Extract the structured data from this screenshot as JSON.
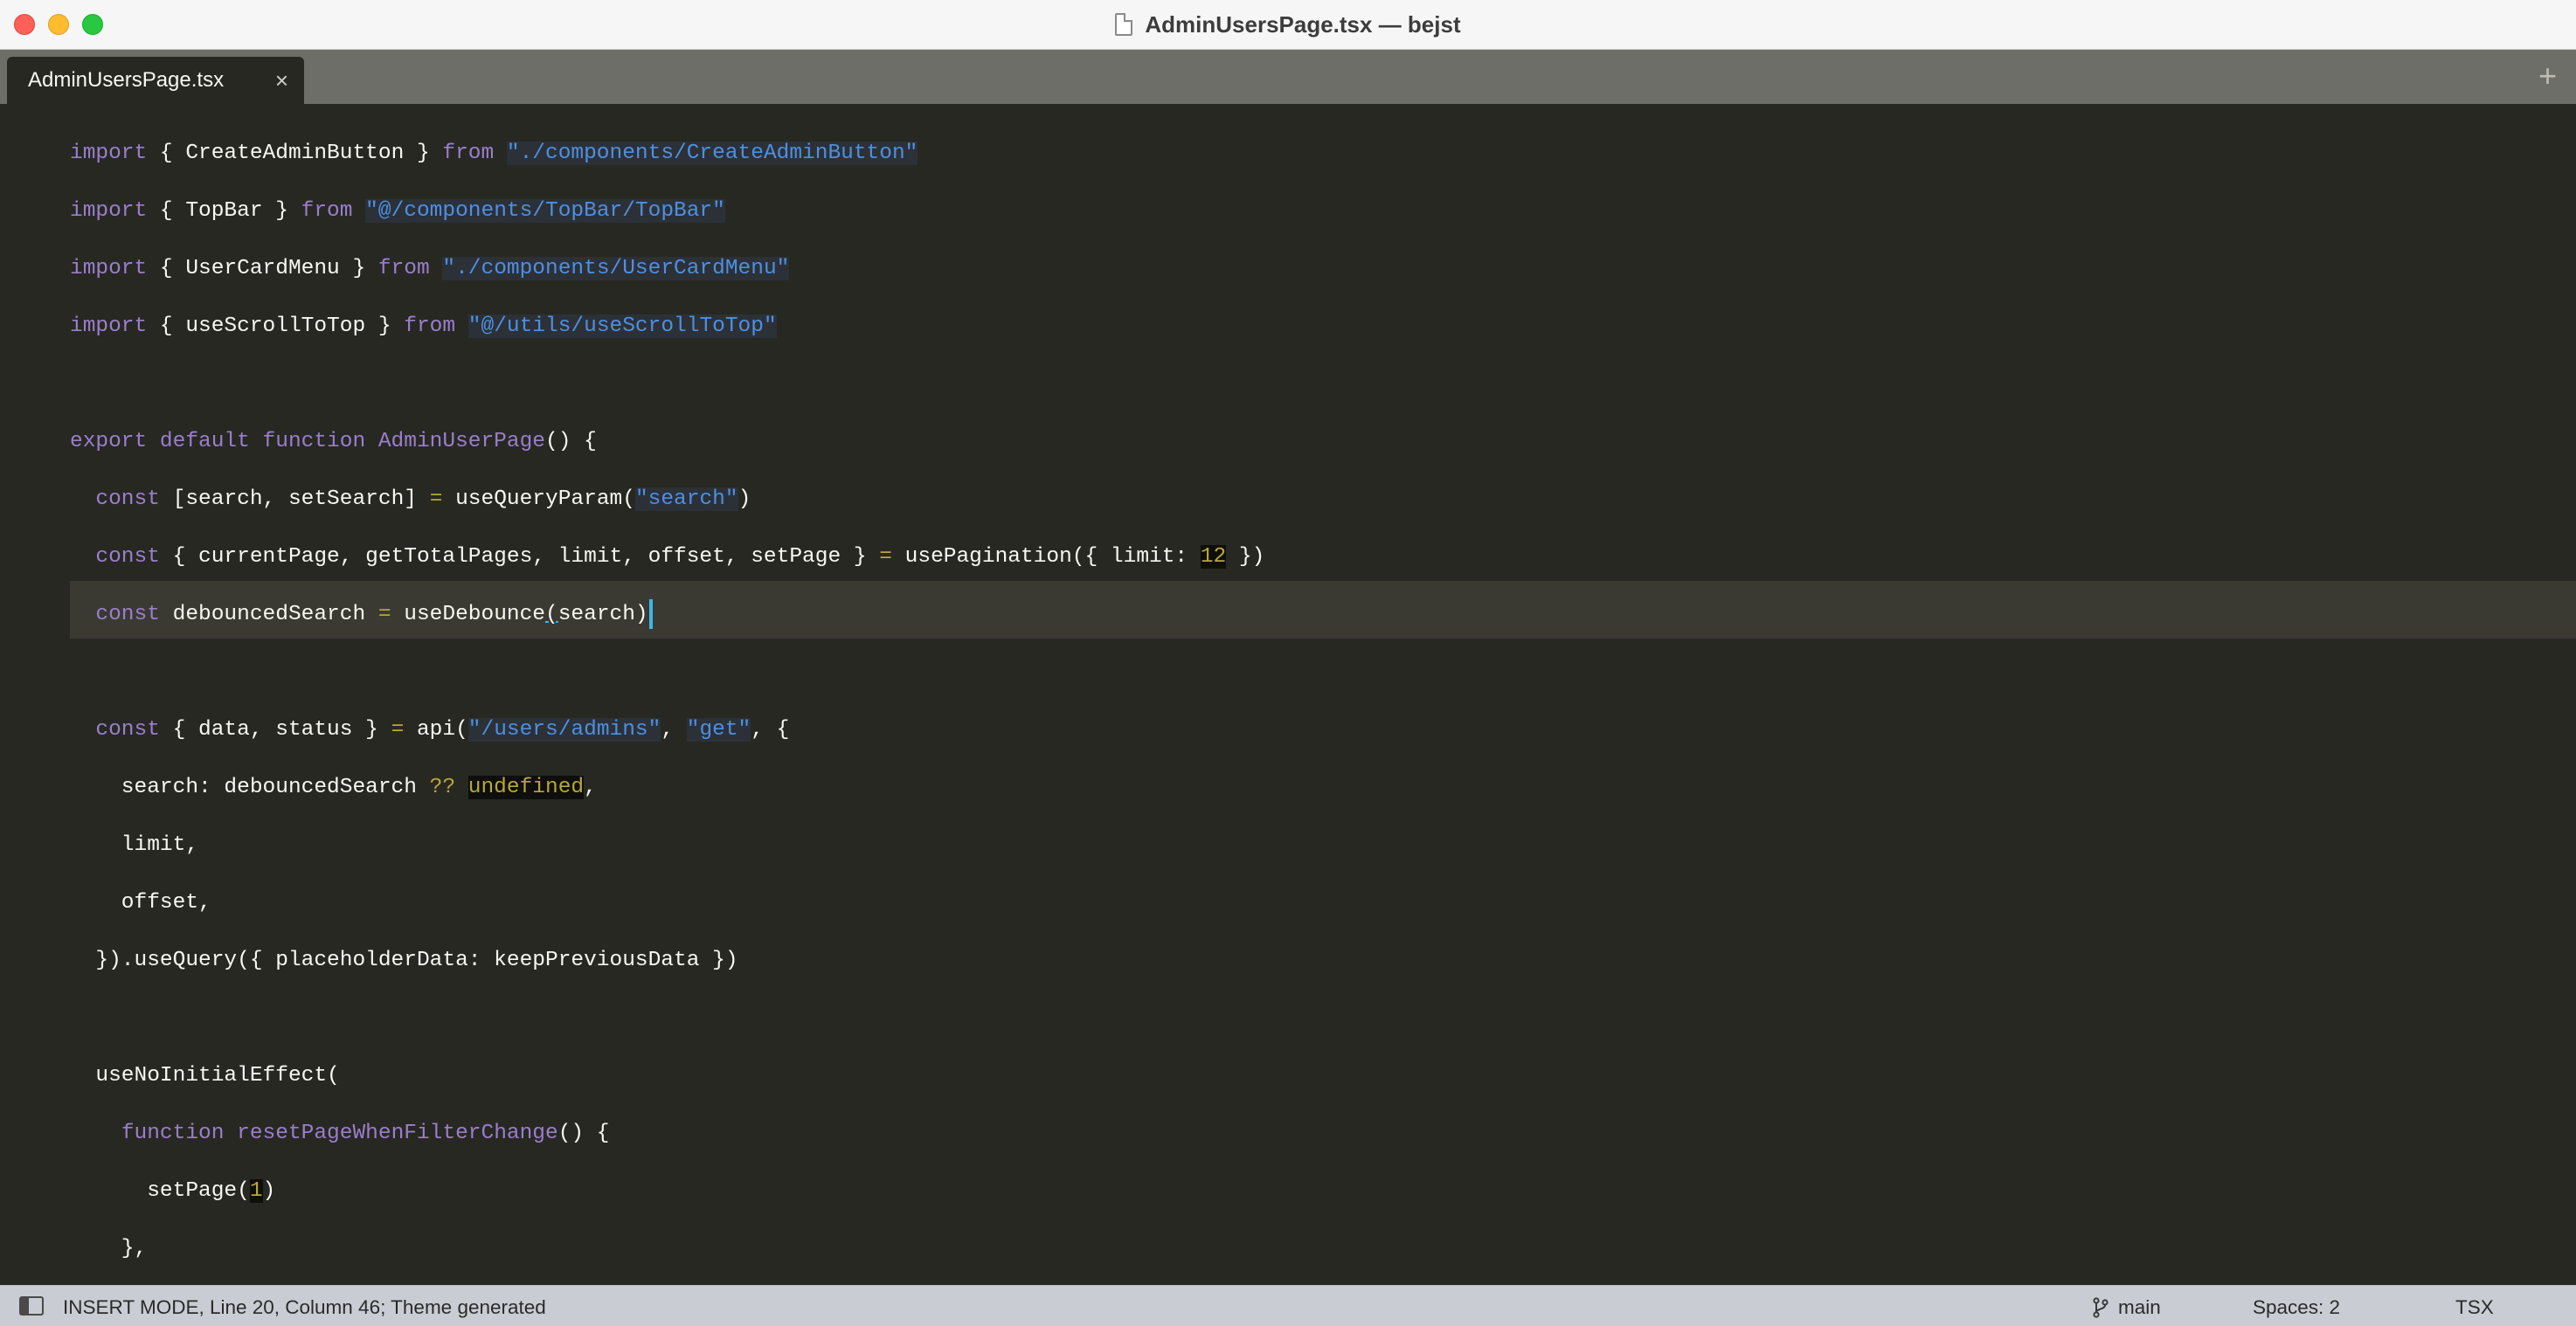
{
  "window": {
    "title": "AdminUsersPage.tsx — bejst"
  },
  "tabs": [
    {
      "label": "AdminUsersPage.tsx",
      "close_label": "×"
    }
  ],
  "tab_add_label": "+",
  "status": {
    "mode_text": "INSERT MODE, Line 20, Column 46; Theme generated",
    "branch": "main",
    "spaces": "Spaces: 2",
    "syntax": "TSX"
  },
  "code": {
    "l1": {
      "a": "import",
      "b": " { CreateAdminButton } ",
      "c": "from",
      "d": " ",
      "e": "\"./components/CreateAdminButton\""
    },
    "l2": {
      "a": "import",
      "b": " { TopBar } ",
      "c": "from",
      "d": " ",
      "e": "\"@/components/TopBar/TopBar\""
    },
    "l3": {
      "a": "import",
      "b": " { UserCardMenu } ",
      "c": "from",
      "d": " ",
      "e": "\"./components/UserCardMenu\""
    },
    "l4": {
      "a": "import",
      "b": " { useScrollToTop } ",
      "c": "from",
      "d": " ",
      "e": "\"@/utils/useScrollToTop\""
    },
    "l5": {
      "a": "export default function",
      "b": " ",
      "c": "AdminUserPage",
      "d": "() {"
    },
    "l6": {
      "a": "  ",
      "b": "const",
      "c": " [search, setSearch] ",
      "d": "=",
      "e": " useQueryParam(",
      "f": "\"search\"",
      "g": ")"
    },
    "l7": {
      "a": "  ",
      "b": "const",
      "c": " { currentPage, getTotalPages, limit, offset, setPage } ",
      "d": "=",
      "e": " usePagination({ limit: ",
      "f": "12",
      "g": " })"
    },
    "l8": {
      "a": "  ",
      "b": "const",
      "c": " debouncedSearch ",
      "d": "=",
      "e": " useDebounce",
      "f": "(",
      "g": "search)"
    },
    "l9": {
      "a": "  ",
      "b": "const",
      "c": " { data, status } ",
      "d": "=",
      "e": " api(",
      "f": "\"/users/admins\"",
      "g": ", ",
      "h": "\"get\"",
      "i": ", {"
    },
    "l10": {
      "a": "    search: debouncedSearch ",
      "b": "??",
      "c": " ",
      "d": "undefined",
      "e": ","
    },
    "l11": {
      "a": "    limit,"
    },
    "l12": {
      "a": "    offset,"
    },
    "l13": {
      "a": "  }).useQuery({ placeholderData: keepPreviousData })"
    },
    "l14": {
      "a": "  useNoInitialEffect("
    },
    "l15": {
      "a": "    ",
      "b": "function",
      "c": " ",
      "d": "resetPageWhenFilterChange",
      "e": "() {"
    },
    "l16": {
      "a": "      setPage(",
      "b": "1",
      "c": ")"
    },
    "l17": {
      "a": "    },"
    }
  },
  "colors": {
    "editor_bg": "#272822",
    "keyword": "#9a7ecc",
    "string": "#4e8fe0",
    "number": "#b9a63a",
    "cursor": "#3bb8e6",
    "statusbar_bg": "#c9cdd3"
  },
  "icons": {
    "window_close": "close-dot-icon",
    "window_min": "minimize-dot-icon",
    "window_max": "maximize-dot-icon",
    "file": "document-icon",
    "sidebar": "sidebar-toggle-icon",
    "branch": "git-branch-icon"
  }
}
